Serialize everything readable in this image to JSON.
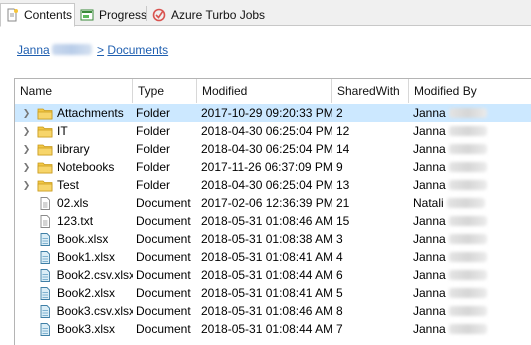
{
  "tabs": [
    {
      "label": "Contents",
      "icon": "contents-icon",
      "active": true
    },
    {
      "label": "Progress",
      "icon": "progress-icon",
      "active": false
    },
    {
      "label": "Azure Turbo Jobs",
      "icon": "azure-jobs-icon",
      "active": false
    }
  ],
  "breadcrumb": {
    "user": "Janna",
    "separator": ">",
    "folder": "Documents"
  },
  "table": {
    "columns": [
      "Name",
      "Type",
      "Modified",
      "SharedWith",
      "Modified By"
    ],
    "rows": [
      {
        "name": "Attachments",
        "kind": "folder",
        "type": "Folder",
        "modified": "2017-10-29 09:20:33 PM",
        "shared": "2",
        "by": "Janna"
      },
      {
        "name": "IT",
        "kind": "folder",
        "type": "Folder",
        "modified": "2018-04-30 06:25:04 PM",
        "shared": "12",
        "by": "Janna"
      },
      {
        "name": "library",
        "kind": "folder",
        "type": "Folder",
        "modified": "2018-04-30 06:25:04 PM",
        "shared": "14",
        "by": "Janna"
      },
      {
        "name": "Notebooks",
        "kind": "folder",
        "type": "Folder",
        "modified": "2017-11-26 06:37:09 PM",
        "shared": "9",
        "by": "Janna"
      },
      {
        "name": "Test",
        "kind": "folder",
        "type": "Folder",
        "modified": "2018-04-30 06:25:04 PM",
        "shared": "13",
        "by": "Janna"
      },
      {
        "name": "02.xls",
        "kind": "doc",
        "type": "Document",
        "modified": "2017-02-06 12:36:39 PM",
        "shared": "21",
        "by": "Natali"
      },
      {
        "name": "123.txt",
        "kind": "doc",
        "type": "Document",
        "modified": "2018-05-31 01:08:46 AM",
        "shared": "15",
        "by": "Janna"
      },
      {
        "name": "Book.xlsx",
        "kind": "sheet",
        "type": "Document",
        "modified": "2018-05-31 01:08:38 AM",
        "shared": "3",
        "by": "Janna"
      },
      {
        "name": "Book1.xlsx",
        "kind": "sheet",
        "type": "Document",
        "modified": "2018-05-31 01:08:41 AM",
        "shared": "4",
        "by": "Janna"
      },
      {
        "name": "Book2.csv.xlsx",
        "kind": "sheet",
        "type": "Document",
        "modified": "2018-05-31 01:08:44 AM",
        "shared": "6",
        "by": "Janna"
      },
      {
        "name": "Book2.xlsx",
        "kind": "sheet",
        "type": "Document",
        "modified": "2018-05-31 01:08:41 AM",
        "shared": "5",
        "by": "Janna"
      },
      {
        "name": "Book3.csv.xlsx",
        "kind": "sheet",
        "type": "Document",
        "modified": "2018-05-31 01:08:46 AM",
        "shared": "8",
        "by": "Janna"
      },
      {
        "name": "Book3.xlsx",
        "kind": "sheet",
        "type": "Document",
        "modified": "2018-05-31 01:08:44 AM",
        "shared": "7",
        "by": "Janna"
      }
    ],
    "selected_index": 0
  },
  "colors": {
    "selection": "#cce8ff",
    "link": "#1f5fb0",
    "folder": "#f2c744"
  }
}
